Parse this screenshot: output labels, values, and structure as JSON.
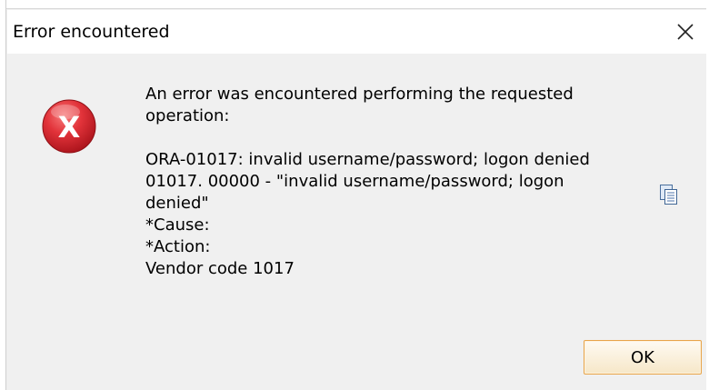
{
  "window": {
    "title": "Error encountered"
  },
  "icons": {
    "close": "close-icon",
    "error": "error-icon",
    "copy": "copy-icon"
  },
  "message": {
    "line1": "An error was encountered performing the requested",
    "line2": "operation:",
    "line3": "ORA-01017: invalid username/password; logon denied",
    "line4": "01017. 00000 -  \"invalid username/password; logon",
    "line5": "denied\"",
    "line6": "*Cause:",
    "line7": "*Action:",
    "line8": "Vendor code 1017"
  },
  "buttons": {
    "ok_label": "OK"
  },
  "colors": {
    "error_red": "#d9232d",
    "ok_border": "#e8a44a",
    "dialog_bg": "#f0f0f0"
  }
}
